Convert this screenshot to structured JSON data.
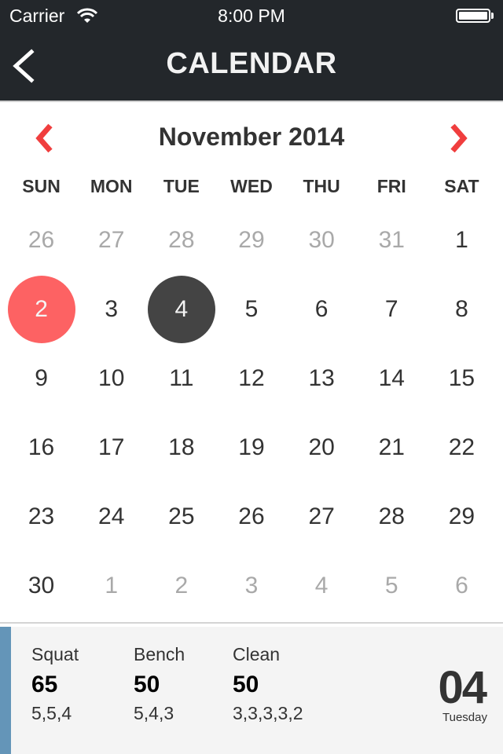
{
  "status_bar": {
    "carrier": "Carrier",
    "time": "8:00 PM",
    "wifi_icon": "wifi-icon",
    "battery_icon": "battery-icon"
  },
  "nav": {
    "title": "CALENDAR",
    "back_icon": "chevron-left-icon"
  },
  "calendar": {
    "month_label": "November 2014",
    "prev_icon": "chevron-left-icon",
    "next_icon": "chevron-right-icon",
    "accent_color": "#f03e3e",
    "weekdays": [
      "SUN",
      "MON",
      "TUE",
      "WED",
      "THU",
      "FRI",
      "SAT"
    ],
    "weeks": [
      [
        {
          "d": "26",
          "m": true
        },
        {
          "d": "27",
          "m": true
        },
        {
          "d": "28",
          "m": true
        },
        {
          "d": "29",
          "m": true
        },
        {
          "d": "30",
          "m": true
        },
        {
          "d": "31",
          "m": true
        },
        {
          "d": "1",
          "m": false
        }
      ],
      [
        {
          "d": "2",
          "m": false,
          "state": "today"
        },
        {
          "d": "3",
          "m": false
        },
        {
          "d": "4",
          "m": false,
          "state": "selected"
        },
        {
          "d": "5",
          "m": false
        },
        {
          "d": "6",
          "m": false
        },
        {
          "d": "7",
          "m": false
        },
        {
          "d": "8",
          "m": false
        }
      ],
      [
        {
          "d": "9",
          "m": false
        },
        {
          "d": "10",
          "m": false
        },
        {
          "d": "11",
          "m": false
        },
        {
          "d": "12",
          "m": false
        },
        {
          "d": "13",
          "m": false
        },
        {
          "d": "14",
          "m": false
        },
        {
          "d": "15",
          "m": false
        }
      ],
      [
        {
          "d": "16",
          "m": false
        },
        {
          "d": "17",
          "m": false
        },
        {
          "d": "18",
          "m": false
        },
        {
          "d": "19",
          "m": false
        },
        {
          "d": "20",
          "m": false
        },
        {
          "d": "21",
          "m": false
        },
        {
          "d": "22",
          "m": false
        }
      ],
      [
        {
          "d": "23",
          "m": false
        },
        {
          "d": "24",
          "m": false
        },
        {
          "d": "25",
          "m": false
        },
        {
          "d": "26",
          "m": false
        },
        {
          "d": "27",
          "m": false
        },
        {
          "d": "28",
          "m": false
        },
        {
          "d": "29",
          "m": false
        }
      ],
      [
        {
          "d": "30",
          "m": false
        },
        {
          "d": "1",
          "m": true
        },
        {
          "d": "2",
          "m": true
        },
        {
          "d": "3",
          "m": true
        },
        {
          "d": "4",
          "m": true
        },
        {
          "d": "5",
          "m": true
        },
        {
          "d": "6",
          "m": true
        }
      ]
    ],
    "today_color": "#fd6263",
    "selected_color": "#444444"
  },
  "detail": {
    "accent_color": "#6495b8",
    "lifts": [
      {
        "name": "Squat",
        "weight": "65",
        "reps": "5,5,4"
      },
      {
        "name": "Bench",
        "weight": "50",
        "reps": "5,4,3"
      },
      {
        "name": "Clean",
        "weight": "50",
        "reps": "3,3,3,3,2"
      }
    ],
    "date_number": "04",
    "date_weekday": "Tuesday"
  }
}
